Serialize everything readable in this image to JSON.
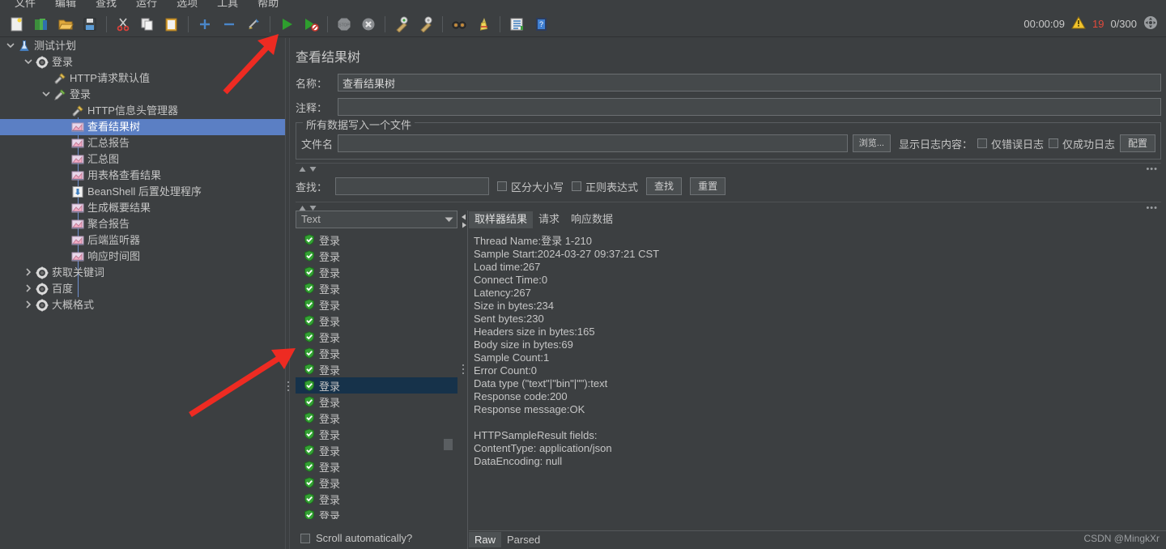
{
  "menubar": {
    "items": [
      "文件",
      "编辑",
      "查找",
      "运行",
      "选项",
      "工具",
      "帮助"
    ]
  },
  "toolbar": {
    "buttons": [
      {
        "name": "new-icon",
        "label": "新建"
      },
      {
        "name": "templates-icon",
        "label": "模板"
      },
      {
        "name": "open-icon",
        "label": "打开"
      },
      {
        "name": "save-icon",
        "label": "保存"
      },
      {
        "name": "cut-icon",
        "label": "剪切"
      },
      {
        "name": "copy-icon",
        "label": "复制"
      },
      {
        "name": "paste-icon",
        "label": "粘贴"
      },
      {
        "name": "expand-icon",
        "label": "展开全部"
      },
      {
        "name": "collapse-icon",
        "label": "收起全部"
      },
      {
        "name": "toggle-icon",
        "label": "切换"
      },
      {
        "name": "start-icon",
        "label": "启动"
      },
      {
        "name": "start-no-pause-icon",
        "label": "无间隔启动"
      },
      {
        "name": "stop-icon",
        "label": "停止"
      },
      {
        "name": "shutdown-icon",
        "label": "关闭"
      },
      {
        "name": "clear-icon",
        "label": "清除"
      },
      {
        "name": "clear-all-icon",
        "label": "清除全部"
      },
      {
        "name": "search-icon",
        "label": "搜索"
      },
      {
        "name": "reset-search-icon",
        "label": "重置搜索"
      },
      {
        "name": "function-helper-icon",
        "label": "函数助手对话框"
      },
      {
        "name": "help-icon",
        "label": "帮助"
      }
    ],
    "status": {
      "elapsed": "00:00:09",
      "warning_icon": "warning-triangle-icon",
      "error_count": "19",
      "threads": "0/300",
      "expand_icon": "expand-status-icon"
    }
  },
  "tree": {
    "nodes": [
      {
        "label": "测试计划",
        "icon": "test-plan-icon",
        "depth": 0,
        "toggle": "expanded",
        "selected": false
      },
      {
        "label": "登录",
        "icon": "thread-group-icon",
        "depth": 1,
        "toggle": "expanded",
        "selected": false
      },
      {
        "label": "HTTP请求默认值",
        "icon": "config-icon",
        "depth": 2,
        "toggle": "none",
        "selected": false
      },
      {
        "label": "登录",
        "icon": "sampler-icon",
        "depth": 2,
        "toggle": "expanded",
        "selected": false
      },
      {
        "label": "HTTP信息头管理器",
        "icon": "config-icon",
        "depth": 3,
        "toggle": "none",
        "selected": false
      },
      {
        "label": "查看结果树",
        "icon": "listener-icon",
        "depth": 3,
        "toggle": "none",
        "selected": true
      },
      {
        "label": "汇总报告",
        "icon": "listener-icon",
        "depth": 3,
        "toggle": "none",
        "selected": false
      },
      {
        "label": "汇总图",
        "icon": "listener-icon",
        "depth": 3,
        "toggle": "none",
        "selected": false
      },
      {
        "label": "用表格查看结果",
        "icon": "listener-icon",
        "depth": 3,
        "toggle": "none",
        "selected": false
      },
      {
        "label": "BeanShell 后置处理程序",
        "icon": "beanshell-icon",
        "depth": 3,
        "toggle": "none",
        "selected": false
      },
      {
        "label": "生成概要结果",
        "icon": "listener-icon",
        "depth": 3,
        "toggle": "none",
        "selected": false
      },
      {
        "label": "聚合报告",
        "icon": "listener-icon",
        "depth": 3,
        "toggle": "none",
        "selected": false
      },
      {
        "label": "后端监听器",
        "icon": "listener-icon",
        "depth": 3,
        "toggle": "none",
        "selected": false
      },
      {
        "label": "响应时间图",
        "icon": "listener-icon",
        "depth": 3,
        "toggle": "none",
        "selected": false
      },
      {
        "label": "获取关键词",
        "icon": "thread-group-icon",
        "depth": 1,
        "toggle": "collapsed",
        "selected": false
      },
      {
        "label": "百度",
        "icon": "thread-group-icon",
        "depth": 1,
        "toggle": "collapsed",
        "selected": false
      },
      {
        "label": "大概格式",
        "icon": "thread-group-icon",
        "depth": 1,
        "toggle": "collapsed",
        "selected": false
      }
    ]
  },
  "panel": {
    "title": "查看结果树",
    "name_label": "名称：",
    "name_value": "查看结果树",
    "comment_label": "注释：",
    "comment_value": "",
    "file_group_title": "所有数据写入一个文件",
    "filename_label": "文件名",
    "filename_value": "",
    "browse_button": "浏览...",
    "log_display_label": "显示日志内容：",
    "errors_only": "仅错误日志",
    "success_only": "仅成功日志",
    "configure_button": "配置"
  },
  "search": {
    "label": "查找：",
    "value": "",
    "case_sensitive": "区分大小写",
    "regex": "正则表达式",
    "find_button": "查找",
    "reset_button": "重置"
  },
  "results": {
    "renderer_value": "Text",
    "items": [
      {
        "label": "登录",
        "status": "success",
        "selected": false
      },
      {
        "label": "登录",
        "status": "success",
        "selected": false
      },
      {
        "label": "登录",
        "status": "success",
        "selected": false
      },
      {
        "label": "登录",
        "status": "success",
        "selected": false
      },
      {
        "label": "登录",
        "status": "success",
        "selected": false
      },
      {
        "label": "登录",
        "status": "success",
        "selected": false
      },
      {
        "label": "登录",
        "status": "success",
        "selected": false
      },
      {
        "label": "登录",
        "status": "success",
        "selected": false
      },
      {
        "label": "登录",
        "status": "success",
        "selected": false
      },
      {
        "label": "登录",
        "status": "success",
        "selected": true
      },
      {
        "label": "登录",
        "status": "success",
        "selected": false
      },
      {
        "label": "登录",
        "status": "success",
        "selected": false
      },
      {
        "label": "登录",
        "status": "success",
        "selected": false
      },
      {
        "label": "登录",
        "status": "success",
        "selected": false
      },
      {
        "label": "登录",
        "status": "success",
        "selected": false
      },
      {
        "label": "登录",
        "status": "success",
        "selected": false
      },
      {
        "label": "登录",
        "status": "success",
        "selected": false
      },
      {
        "label": "登录",
        "status": "success",
        "selected": false
      },
      {
        "label": "登录",
        "status": "success",
        "selected": false
      }
    ],
    "scroll_automatically": "Scroll automatically?",
    "tabs": [
      {
        "label": "取样器结果",
        "active": true
      },
      {
        "label": "请求",
        "active": false
      },
      {
        "label": "响应数据",
        "active": false
      }
    ],
    "detail_lines": [
      "Thread Name:登录 1-210",
      "Sample Start:2024-03-27 09:37:21 CST",
      "Load time:267",
      "Connect Time:0",
      "Latency:267",
      "Size in bytes:234",
      "Sent bytes:230",
      "Headers size in bytes:165",
      "Body size in bytes:69",
      "Sample Count:1",
      "Error Count:0",
      "Data type (\"text\"|\"bin\"|\"\"):text",
      "Response code:200",
      "Response message:OK"
    ],
    "detail_lines2": [
      "HTTPSampleResult fields:",
      "ContentType: application/json",
      "DataEncoding: null"
    ],
    "bottom_tabs": [
      {
        "label": "Raw",
        "active": true
      },
      {
        "label": "Parsed",
        "active": false
      }
    ]
  },
  "watermark": "CSDN @MingkXr",
  "colors": {
    "background": "#3c3f41",
    "tree_selection": "#5b7fc4",
    "list_selection": "#16324a",
    "error_red": "#e24a3c",
    "success_green": "#3fa93f",
    "annotation_red": "#ee2b22"
  }
}
